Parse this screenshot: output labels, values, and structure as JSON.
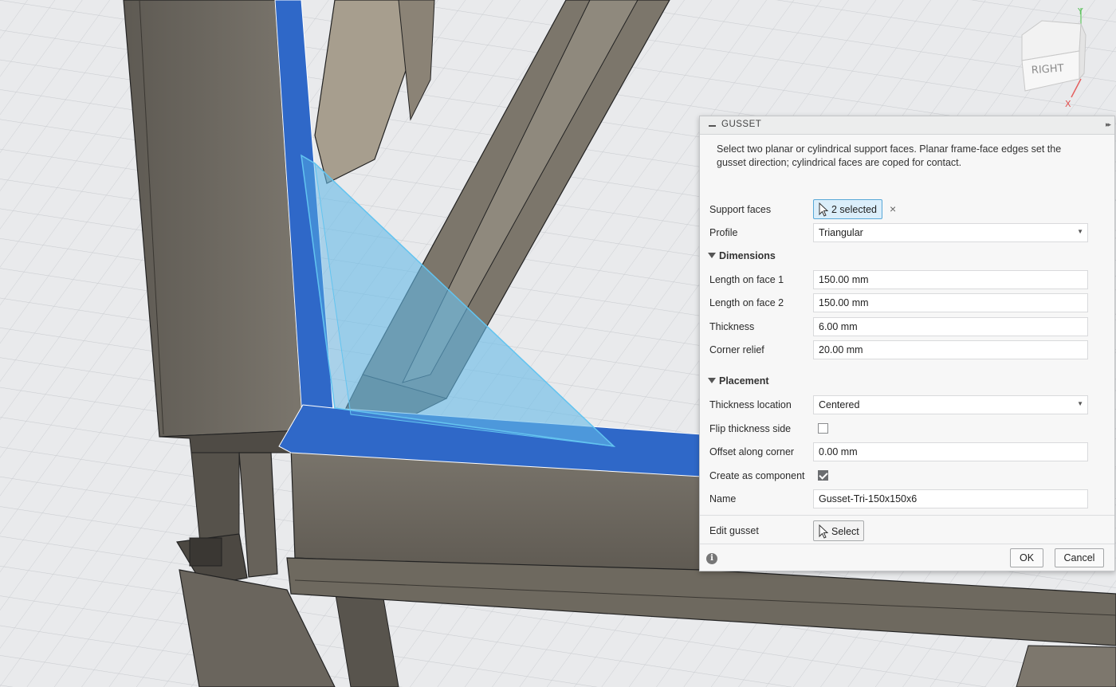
{
  "viewcube": {
    "face_label": "RIGHT",
    "axis_y": "Y",
    "axis_x": "X"
  },
  "dialog": {
    "title": "GUSSET",
    "description": "Select two planar or cylindrical support faces. Planar frame-face edges set the gusset direction; cylindrical faces are coped for contact.",
    "support_faces": {
      "label": "Support faces",
      "value": "2 selected",
      "clear_glyph": "×"
    },
    "profile": {
      "label": "Profile",
      "value": "Triangular"
    },
    "dimensions": {
      "title": "Dimensions",
      "length_face1": {
        "label": "Length on face 1",
        "value": "150.00 mm"
      },
      "length_face2": {
        "label": "Length on face 2",
        "value": "150.00 mm"
      },
      "thickness": {
        "label": "Thickness",
        "value": "6.00 mm"
      },
      "corner_relief": {
        "label": "Corner relief",
        "value": "20.00 mm"
      }
    },
    "placement": {
      "title": "Placement",
      "thickness_location": {
        "label": "Thickness location",
        "value": "Centered"
      },
      "flip_thickness": {
        "label": "Flip thickness side",
        "checked": false
      },
      "offset_corner": {
        "label": "Offset along corner",
        "value": "0.00 mm"
      },
      "create_component": {
        "label": "Create as component",
        "checked": true
      },
      "name": {
        "label": "Name",
        "value": "Gusset-Tri-150x150x6"
      }
    },
    "edit_gusset": {
      "label": "Edit gusset",
      "button": "Select"
    },
    "ok_label": "OK",
    "cancel_label": "Cancel",
    "info_glyph": "i"
  },
  "colors": {
    "selection_blue": "#2f68c8",
    "gusset_preview": "#5ab4e6",
    "steel_dark": "#6f6a62",
    "steel_light": "#8f897f"
  }
}
